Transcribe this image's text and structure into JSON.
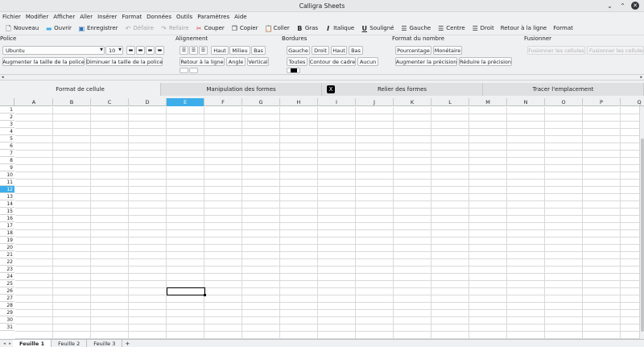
{
  "window": {
    "title": "Calligra Sheets"
  },
  "menu": [
    "Fichier",
    "Modifier",
    "Afficher",
    "Aller",
    "Insérer",
    "Format",
    "Données",
    "Outils",
    "Paramètres",
    "Aide"
  ],
  "toolbar": {
    "new": "Nouveau",
    "open": "Ouvrir",
    "save": "Enregistrer",
    "undo": "Défaire",
    "redo": "Refaire",
    "cut": "Couper",
    "copy": "Copier",
    "paste": "Coller",
    "bold": "Gras",
    "italic": "Italique",
    "underline": "Souligné",
    "left": "Gauche",
    "center": "Centre",
    "right": "Droit",
    "wrap": "Retour à la ligne",
    "format": "Format"
  },
  "ribbon": {
    "police": {
      "title": "Police",
      "font": "Ubuntu",
      "size": "10",
      "grow": "Augmenter la taille de la police",
      "shrink": "Diminuer la taille de la police"
    },
    "alignement": {
      "title": "Alignement",
      "top": "Haut",
      "middle": "Milieu",
      "bottom": "Bas",
      "wrap": "Retour à la ligne",
      "angle": "Angle",
      "vertical": "Vertical"
    },
    "bordures": {
      "title": "Bordures",
      "left": "Gauche",
      "right": "Droit",
      "top": "Haut",
      "bottom": "Bas",
      "all": "Toutes",
      "outline": "Contour de cadre",
      "none": "Aucun"
    },
    "nombre": {
      "title": "Format du nombre",
      "percent": "Pourcentage",
      "money": "Monétaire",
      "inc": "Augmenter la précision",
      "dec": "Réduire la précision"
    },
    "fusion": {
      "title": "Fusionner",
      "merge": "Fusionner les cellules",
      "merge_h": "Fusionner les cellules h"
    }
  },
  "tabs": [
    "Format de cellule",
    "Manipulation des formes",
    "Relier des formes",
    "Tracer l'emplacement"
  ],
  "columns": [
    "A",
    "B",
    "C",
    "D",
    "E",
    "F",
    "G",
    "H",
    "I",
    "J",
    "K",
    "L",
    "M",
    "N",
    "O",
    "P",
    "Q"
  ],
  "rows": [
    "1",
    "2",
    "3",
    "4",
    "5",
    "6",
    "7",
    "8",
    "9",
    "10",
    "11",
    "12",
    "13",
    "14",
    "15",
    "16",
    "17",
    "18",
    "19",
    "20",
    "21",
    "22",
    "23",
    "24",
    "25",
    "26",
    "27",
    "28",
    "29",
    "30",
    "31"
  ],
  "selected": {
    "column": "E",
    "row": "12"
  },
  "sheets": [
    "Feuille 1",
    "Feuille 2",
    "Feuille 3"
  ],
  "colors": {
    "accent": "#3daee9",
    "selection_border": "#000000"
  }
}
